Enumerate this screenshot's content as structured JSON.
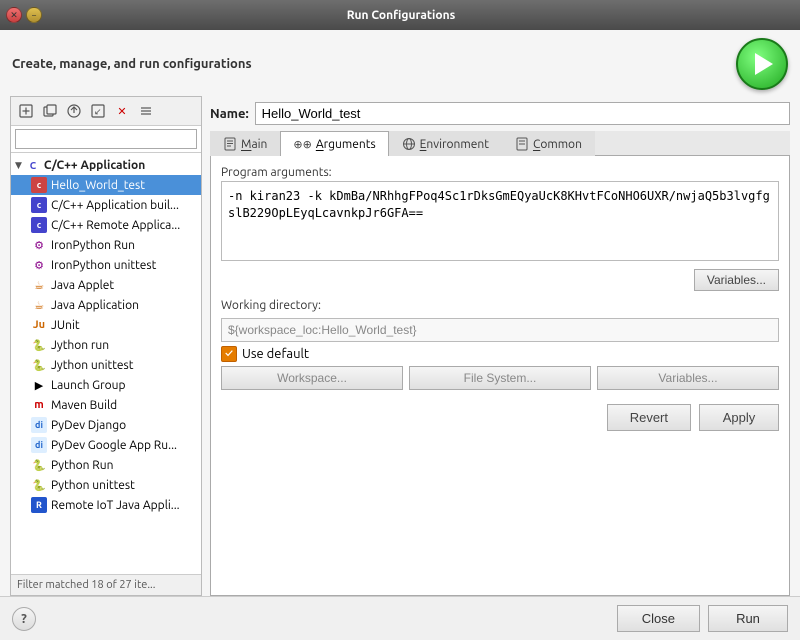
{
  "titlebar": {
    "title": "Run Configurations"
  },
  "header": {
    "subtitle": "Create, manage, and run configurations"
  },
  "left_toolbar": {
    "buttons": [
      {
        "name": "new-config-button",
        "icon": "□",
        "title": "New launch configuration"
      },
      {
        "name": "duplicate-button",
        "icon": "⊞",
        "title": "Duplicate"
      },
      {
        "name": "export-button",
        "icon": "↗",
        "title": "Export"
      },
      {
        "name": "import-button",
        "icon": "↙",
        "title": "Import"
      },
      {
        "name": "delete-button",
        "icon": "✕",
        "title": "Delete"
      },
      {
        "name": "collapse-button",
        "icon": "≡",
        "title": "Collapse All"
      }
    ]
  },
  "search": {
    "placeholder": ""
  },
  "tree": {
    "group": "C/C++ Application",
    "items": [
      {
        "label": "Hello_World_test",
        "selected": true,
        "type": "c"
      },
      {
        "label": "C/C++ Application buil...",
        "selected": false,
        "type": "c"
      },
      {
        "label": "C/C++ Remote Applica...",
        "selected": false,
        "type": "c"
      },
      {
        "label": "IronPython Run",
        "selected": false,
        "type": "iron"
      },
      {
        "label": "IronPython unittest",
        "selected": false,
        "type": "iron"
      },
      {
        "label": "Java Applet",
        "selected": false,
        "type": "java"
      },
      {
        "label": "Java Application",
        "selected": false,
        "type": "java"
      },
      {
        "label": "JUnit",
        "selected": false,
        "type": "junit"
      },
      {
        "label": "Jython run",
        "selected": false,
        "type": "jython"
      },
      {
        "label": "Jython unittest",
        "selected": false,
        "type": "jython"
      },
      {
        "label": "Launch Group",
        "selected": false,
        "type": "launch"
      },
      {
        "label": "Maven Build",
        "selected": false,
        "type": "maven"
      },
      {
        "label": "PyDev Django",
        "selected": false,
        "type": "pydev"
      },
      {
        "label": "PyDev Google App Ru...",
        "selected": false,
        "type": "pydev"
      },
      {
        "label": "Python Run",
        "selected": false,
        "type": "python"
      },
      {
        "label": "Python unittest",
        "selected": false,
        "type": "python"
      },
      {
        "label": "Remote IoT Java Appli...",
        "selected": false,
        "type": "remote"
      }
    ],
    "filter_text": "Filter matched 18 of 27 ite..."
  },
  "name_field": {
    "label": "Name:",
    "value": "Hello_World_test"
  },
  "tabs": [
    {
      "label": "Main",
      "icon": "📄",
      "active": false,
      "underline_char": "M"
    },
    {
      "label": "Arguments",
      "icon": "⊕⊕",
      "active": true,
      "underline_char": "A"
    },
    {
      "label": "Environment",
      "icon": "🌐",
      "active": false,
      "underline_char": "E"
    },
    {
      "label": "Common",
      "icon": "📋",
      "active": false,
      "underline_char": "C"
    }
  ],
  "arguments_tab": {
    "program_args_label": "Program arguments:",
    "program_args_value": "-n kiran23 -k kDmBa/NRhhgFPoq4Sc1rDksGmEQyaUcK8KHvtFCoNHO6UXR/nwjaQ5b3lvgfgslB229OpLEyqLcavnkpJr6GFA==",
    "variables_button": "Variables...",
    "working_dir_label": "Working directory:",
    "working_dir_value": "${workspace_loc:Hello_World_test}",
    "use_default_label": "Use default",
    "workspace_button": "Workspace...",
    "filesystem_button": "File System...",
    "variables2_button": "Variables..."
  },
  "action_buttons": {
    "revert_label": "Revert",
    "apply_label": "Apply"
  },
  "bottom_bar": {
    "close_label": "Close",
    "run_label": "Run"
  }
}
